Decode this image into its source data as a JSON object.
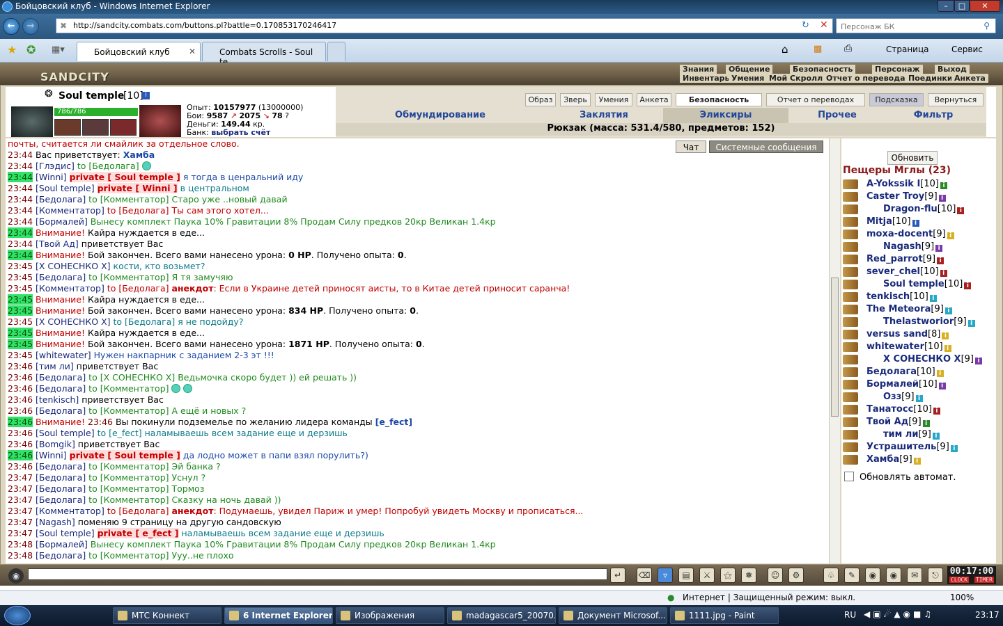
{
  "window": {
    "title": "Бойцовский клуб - Windows Internet Explorer"
  },
  "browser": {
    "url": "http://sandcity.combats.com/buttons.pl?battle=0.170853170246417",
    "search_placeholder": "Персонаж БК",
    "tabs": [
      "Бойцовский клуб",
      "Combats Scrolls - Soul te..."
    ],
    "toolbar": {
      "page": "Страница",
      "tools": "Сервис"
    },
    "status_text": "Интернет | Защищенный режим: выкл.",
    "zoom": "100%"
  },
  "game": {
    "logo": "SANDCITY",
    "top_menu_row1": [
      "Знания",
      "Общение",
      "Безопасность",
      "Персонаж",
      "Выход"
    ],
    "top_menu_row2": [
      "Инвентарь",
      "Умения",
      "Мой Скролл",
      "Отчет о переводах",
      "Поединки",
      "Анкета"
    ],
    "player": {
      "name": "Soul temple",
      "level": "[10]",
      "hp": "786/786",
      "exp_label": "Опыт:",
      "exp": "10157977",
      "exp_next": "(13000000)",
      "battles_label": "Бои:",
      "wins": "9587",
      "losses": "2075",
      "draws": "78",
      "money_label": "Деньги:",
      "money": "149.44",
      "money_unit": "кр.",
      "bank_label": "Банк:",
      "bank_value": "выбрать счёт"
    },
    "header_buttons": [
      "Образ",
      "Зверь",
      "Умения",
      "Анкета",
      "Безопасность",
      "Отчет о переводах",
      "Подсказка",
      "Вернуться"
    ],
    "categories": [
      "Обмундирование",
      "Заклятия",
      "Эликсиры",
      "Прочее",
      "Фильтр"
    ],
    "backpack": "Рюкзак (масса: 531.4/580, предметов: 152)",
    "chat_tabs": [
      "Чат",
      "Системные сообщения"
    ],
    "chat": [
      {
        "time": "",
        "hl": false,
        "parts": [
          {
            "c": "red",
            "t": "почты, считается ли смайлик за отдельное слово."
          }
        ]
      },
      {
        "time": "23:44",
        "hl": false,
        "parts": [
          {
            "c": "",
            "t": "Вас приветствует: "
          },
          {
            "c": "blub",
            "t": "Хамба"
          }
        ]
      },
      {
        "time": "23:44",
        "hl": false,
        "parts": [
          {
            "c": "nm",
            "t": "[Глэдис]"
          },
          {
            "c": "grn",
            "t": " to [Бедолага] "
          },
          {
            "c": "smile",
            "t": ""
          }
        ]
      },
      {
        "time": "23:44",
        "hl": true,
        "parts": [
          {
            "c": "nm",
            "t": "[Winni]"
          },
          {
            "c": "",
            "t": " "
          },
          {
            "c": "pv",
            "t": "private [ Soul temple ]"
          },
          {
            "c": "blu",
            "t": " я тогда в ценральний иду"
          }
        ]
      },
      {
        "time": "23:44",
        "hl": false,
        "parts": [
          {
            "c": "nm",
            "t": "[Soul temple]"
          },
          {
            "c": "",
            "t": " "
          },
          {
            "c": "pv",
            "t": "private [ Winni ]"
          },
          {
            "c": "cyan",
            "t": " в центральном"
          }
        ]
      },
      {
        "time": "23:44",
        "hl": false,
        "parts": [
          {
            "c": "nm",
            "t": "[Бедолага]"
          },
          {
            "c": "grn",
            "t": " to [Комментатор] Старо уже ..новый давай"
          }
        ]
      },
      {
        "time": "23:44",
        "hl": false,
        "parts": [
          {
            "c": "nm",
            "t": "[Комментатор]"
          },
          {
            "c": "red",
            "t": " to [Бедолага] Ты сам этого хотел..."
          }
        ]
      },
      {
        "time": "23:44",
        "hl": false,
        "parts": [
          {
            "c": "nm",
            "t": "[Бормалей]"
          },
          {
            "c": "grn",
            "t": " Вынесу комплект Паука 10% Гравитации 8% Продам Силу предков 20кр Великан 1.4кр"
          }
        ]
      },
      {
        "time": "23:44",
        "hl": true,
        "parts": [
          {
            "c": "red",
            "t": "Внимание!"
          },
          {
            "c": "",
            "t": " Кайра нуждается в еде..."
          }
        ]
      },
      {
        "time": "23:44",
        "hl": false,
        "parts": [
          {
            "c": "nm",
            "t": "[Твой Ад]"
          },
          {
            "c": "",
            "t": " приветствует Вас"
          }
        ]
      },
      {
        "time": "23:44",
        "hl": true,
        "parts": [
          {
            "c": "red",
            "t": "Внимание!"
          },
          {
            "c": "",
            "t": " Бой закончен. Всего вами нанесено урона: "
          },
          {
            "c": "b",
            "t": "0 HP"
          },
          {
            "c": "",
            "t": ". Получено опыта: "
          },
          {
            "c": "b",
            "t": "0"
          },
          {
            "c": "",
            "t": "."
          }
        ]
      },
      {
        "time": "23:45",
        "hl": false,
        "parts": [
          {
            "c": "nm",
            "t": "[X СОНЕСНКО X]"
          },
          {
            "c": "cyan",
            "t": " кости, кто возьмет?"
          }
        ]
      },
      {
        "time": "23:45",
        "hl": false,
        "parts": [
          {
            "c": "nm",
            "t": "[Бедолага]"
          },
          {
            "c": "grn",
            "t": " to [Комментатор] Я тя замучяю"
          }
        ]
      },
      {
        "time": "23:45",
        "hl": false,
        "parts": [
          {
            "c": "nm",
            "t": "[Комментатор]"
          },
          {
            "c": "red",
            "t": " to [Бедолага] "
          },
          {
            "c": "redb",
            "t": "анекдот"
          },
          {
            "c": "red",
            "t": ": Если в Украине детей приносят аисты, то в Китае детей приносит саранча!"
          }
        ]
      },
      {
        "time": "23:45",
        "hl": true,
        "parts": [
          {
            "c": "red",
            "t": "Внимание!"
          },
          {
            "c": "",
            "t": " Кайра нуждается в еде..."
          }
        ]
      },
      {
        "time": "23:45",
        "hl": true,
        "parts": [
          {
            "c": "red",
            "t": "Внимание!"
          },
          {
            "c": "",
            "t": " Бой закончен. Всего вами нанесено урона: "
          },
          {
            "c": "b",
            "t": "834 HP"
          },
          {
            "c": "",
            "t": ". Получено опыта: "
          },
          {
            "c": "b",
            "t": "0"
          },
          {
            "c": "",
            "t": "."
          }
        ]
      },
      {
        "time": "23:45",
        "hl": false,
        "parts": [
          {
            "c": "nm",
            "t": "[X СОНЕСНКО X]"
          },
          {
            "c": "cyan",
            "t": " to [Бедолага] я не подойду?"
          }
        ]
      },
      {
        "time": "23:45",
        "hl": true,
        "parts": [
          {
            "c": "red",
            "t": "Внимание!"
          },
          {
            "c": "",
            "t": " Кайра нуждается в еде..."
          }
        ]
      },
      {
        "time": "23:45",
        "hl": true,
        "parts": [
          {
            "c": "red",
            "t": "Внимание!"
          },
          {
            "c": "",
            "t": " Бой закончен. Всего вами нанесено урона: "
          },
          {
            "c": "b",
            "t": "1871 HP"
          },
          {
            "c": "",
            "t": ". Получено опыта: "
          },
          {
            "c": "b",
            "t": "0"
          },
          {
            "c": "",
            "t": "."
          }
        ]
      },
      {
        "time": "23:45",
        "hl": false,
        "parts": [
          {
            "c": "nm",
            "t": "[whitewater]"
          },
          {
            "c": "blu",
            "t": " Нужен накпарник с заданием 2-3 эт !!!"
          }
        ]
      },
      {
        "time": "23:46",
        "hl": false,
        "parts": [
          {
            "c": "nm",
            "t": "[тим ли]"
          },
          {
            "c": "",
            "t": " приветствует Вас"
          }
        ]
      },
      {
        "time": "23:46",
        "hl": false,
        "parts": [
          {
            "c": "nm",
            "t": "[Бедолага]"
          },
          {
            "c": "grn",
            "t": " to [X СОНЕСНКО X] Ведьмочка скоро будет )) ей решать ))"
          }
        ]
      },
      {
        "time": "23:46",
        "hl": false,
        "parts": [
          {
            "c": "nm",
            "t": "[Бедолага]"
          },
          {
            "c": "grn",
            "t": " to [Комментатор] "
          },
          {
            "c": "smile",
            "t": ""
          },
          {
            "c": "smile",
            "t": ""
          }
        ]
      },
      {
        "time": "23:46",
        "hl": false,
        "parts": [
          {
            "c": "nm",
            "t": "[tenkisch]"
          },
          {
            "c": "",
            "t": " приветствует Вас"
          }
        ]
      },
      {
        "time": "23:46",
        "hl": false,
        "parts": [
          {
            "c": "nm",
            "t": "[Бедолага]"
          },
          {
            "c": "grn",
            "t": " to [Комментатор] А ещё и новых ?"
          }
        ]
      },
      {
        "time": "23:46",
        "hl": true,
        "parts": [
          {
            "c": "red",
            "t": "Внимание!"
          },
          {
            "c": "t",
            "t": " 23:46"
          },
          {
            "c": "",
            "t": " Вы покинули подземелье по желанию лидера команды "
          },
          {
            "c": "blub",
            "t": "[e_fect]"
          }
        ]
      },
      {
        "time": "23:46",
        "hl": false,
        "parts": [
          {
            "c": "nm",
            "t": "[Soul temple]"
          },
          {
            "c": "cyan",
            "t": " to [e_fect] наламываешь всем задание еще и дерзишь"
          }
        ]
      },
      {
        "time": "23:46",
        "hl": false,
        "parts": [
          {
            "c": "nm",
            "t": "[Bomgik]"
          },
          {
            "c": "",
            "t": " приветствует Вас"
          }
        ]
      },
      {
        "time": "23:46",
        "hl": true,
        "parts": [
          {
            "c": "nm",
            "t": "[Winni]"
          },
          {
            "c": "",
            "t": " "
          },
          {
            "c": "pv",
            "t": "private [ Soul temple ]"
          },
          {
            "c": "blu",
            "t": " да лодно может в папи взял порулить?)"
          }
        ]
      },
      {
        "time": "23:46",
        "hl": false,
        "parts": [
          {
            "c": "nm",
            "t": "[Бедолага]"
          },
          {
            "c": "grn",
            "t": " to [Комментатор] Эй банка ?"
          }
        ]
      },
      {
        "time": "23:47",
        "hl": false,
        "parts": [
          {
            "c": "nm",
            "t": "[Бедолага]"
          },
          {
            "c": "grn",
            "t": " to [Комментатор] Уснул ?"
          }
        ]
      },
      {
        "time": "23:47",
        "hl": false,
        "parts": [
          {
            "c": "nm",
            "t": "[Бедолага]"
          },
          {
            "c": "grn",
            "t": " to [Комментатор] Тормоз"
          }
        ]
      },
      {
        "time": "23:47",
        "hl": false,
        "parts": [
          {
            "c": "nm",
            "t": "[Бедолага]"
          },
          {
            "c": "grn",
            "t": " to [Комментатор] Сказку на ночь давай ))"
          }
        ]
      },
      {
        "time": "23:47",
        "hl": false,
        "parts": [
          {
            "c": "nm",
            "t": "[Комментатор]"
          },
          {
            "c": "red",
            "t": " to [Бедолага] "
          },
          {
            "c": "redb",
            "t": "анекдот"
          },
          {
            "c": "red",
            "t": ": Подумаешь, увидел Париж и умер! Попробуй увидеть Москву и прописаться..."
          }
        ]
      },
      {
        "time": "23:47",
        "hl": false,
        "parts": [
          {
            "c": "nm",
            "t": "[Nagash]"
          },
          {
            "c": "",
            "t": " поменяю 9 страницу на другую сандовскую"
          }
        ]
      },
      {
        "time": "23:47",
        "hl": false,
        "parts": [
          {
            "c": "nm",
            "t": "[Soul temple]"
          },
          {
            "c": "",
            "t": " "
          },
          {
            "c": "pv",
            "t": "private [ e_fect ]"
          },
          {
            "c": "cyan",
            "t": " наламываешь всем задание еще и дерзишь"
          }
        ]
      },
      {
        "time": "23:48",
        "hl": false,
        "parts": [
          {
            "c": "nm",
            "t": "[Бормалей]"
          },
          {
            "c": "grn",
            "t": " Вынесу комплект Паука 10% Гравитации 8% Продам Силу предков 20кр Великан 1.4кр"
          }
        ]
      },
      {
        "time": "23:48",
        "hl": false,
        "parts": [
          {
            "c": "nm",
            "t": "[Бедолага]"
          },
          {
            "c": "grn",
            "t": " to [Комментатор] Ууу..не плохо"
          }
        ]
      }
    ],
    "sidebar": {
      "refresh": "Обновить",
      "location": "Пещеры Мглы (23)",
      "auto_refresh": "Обновлять автомат.",
      "players": [
        {
          "name": "A-Yokssik I",
          "lvl": "[10]",
          "badge": "#2a8a2a"
        },
        {
          "name": "Caster Troy",
          "lvl": "[9]",
          "badge": "#7a3aa8"
        },
        {
          "name": "Dragon-flu",
          "lvl": "[10]",
          "badge": "#a82020"
        },
        {
          "name": "Mitja",
          "lvl": "[10]",
          "badge": "#2a5ab8"
        },
        {
          "name": "moxa-docent",
          "lvl": "[9]",
          "badge": "#d8b020"
        },
        {
          "name": "Nagash",
          "lvl": "[9]",
          "badge": "#7a3aa8"
        },
        {
          "name": "Red_parrot",
          "lvl": "[9]",
          "badge": "#a82020"
        },
        {
          "name": "sever_chel",
          "lvl": "[10]",
          "badge": "#a82020"
        },
        {
          "name": "Soul temple",
          "lvl": "[10]",
          "badge": "#a82020"
        },
        {
          "name": "tenkisch",
          "lvl": "[10]",
          "badge": "#28a8c8"
        },
        {
          "name": "The Meteora",
          "lvl": "[9]",
          "badge": "#28a8c8"
        },
        {
          "name": "Thelastworior",
          "lvl": "[9]",
          "badge": "#28a8c8"
        },
        {
          "name": "versus sand",
          "lvl": "[8]",
          "badge": "#d8b020"
        },
        {
          "name": "whitewater",
          "lvl": "[10]",
          "badge": "#d8b020"
        },
        {
          "name": "X СОНЕСНКО X",
          "lvl": "[9]",
          "badge": "#7a3aa8"
        },
        {
          "name": "Бедолага",
          "lvl": "[10]",
          "badge": "#d8b020"
        },
        {
          "name": "Бормалей",
          "lvl": "[10]",
          "badge": "#7a3aa8"
        },
        {
          "name": "Озз",
          "lvl": "[9]",
          "badge": "#28a8c8"
        },
        {
          "name": "Танатосс",
          "lvl": "[10]",
          "badge": "#a82020"
        },
        {
          "name": "Твой Ад",
          "lvl": "[9]",
          "badge": "#2a8a2a"
        },
        {
          "name": "тим ли",
          "lvl": "[9]",
          "badge": "#28a8c8"
        },
        {
          "name": "Устрашитель",
          "lvl": "[9]",
          "badge": "#28a8c8"
        },
        {
          "name": "Хамба",
          "lvl": "[9]",
          "badge": "#d8b020"
        }
      ]
    },
    "clock": "00:17:00",
    "clock_labels": [
      "CLOCK",
      "TIMER"
    ]
  },
  "taskbar": {
    "items": [
      "МТС Коннект",
      "6 Internet Explorer",
      "Изображения",
      "madagascar5_20070...",
      "Документ Microsof...",
      "1111.jpg - Paint"
    ],
    "lang": "RU",
    "time": "23:17"
  }
}
